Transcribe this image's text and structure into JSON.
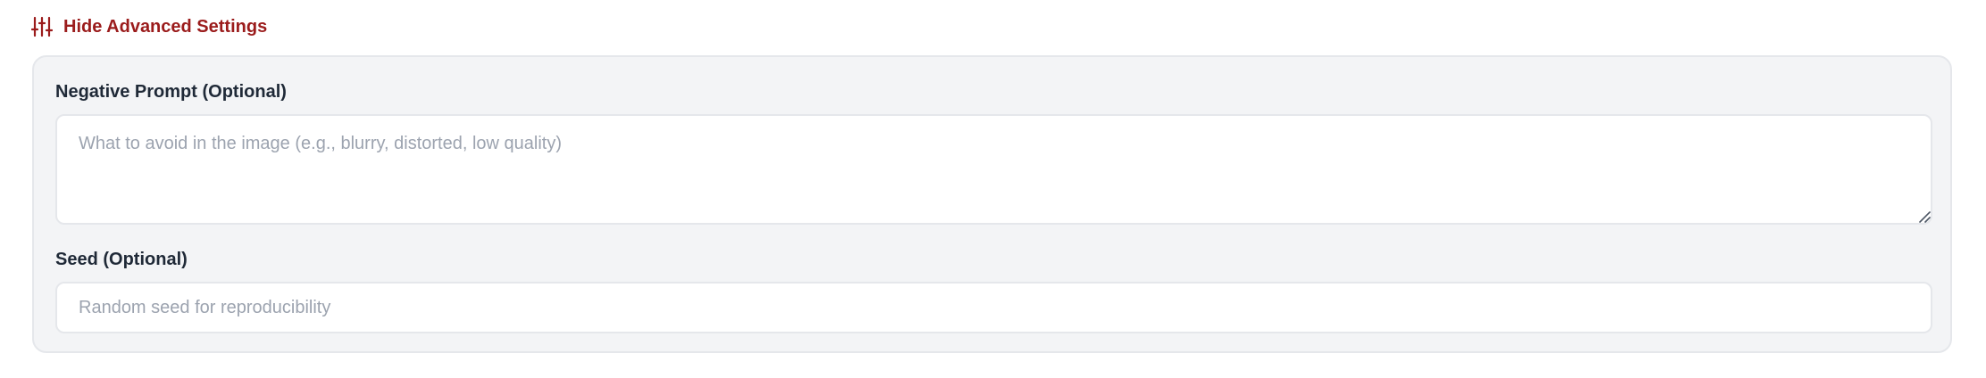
{
  "advanced_toggle": {
    "label": "Hide Advanced Settings",
    "icon": "sliders-icon",
    "color": "#9b1c1c"
  },
  "negative_prompt": {
    "label": "Negative Prompt (Optional)",
    "placeholder": "What to avoid in the image (e.g., blurry, distorted, low quality)",
    "value": ""
  },
  "seed": {
    "label": "Seed (Optional)",
    "placeholder": "Random seed for reproducibility",
    "value": ""
  }
}
